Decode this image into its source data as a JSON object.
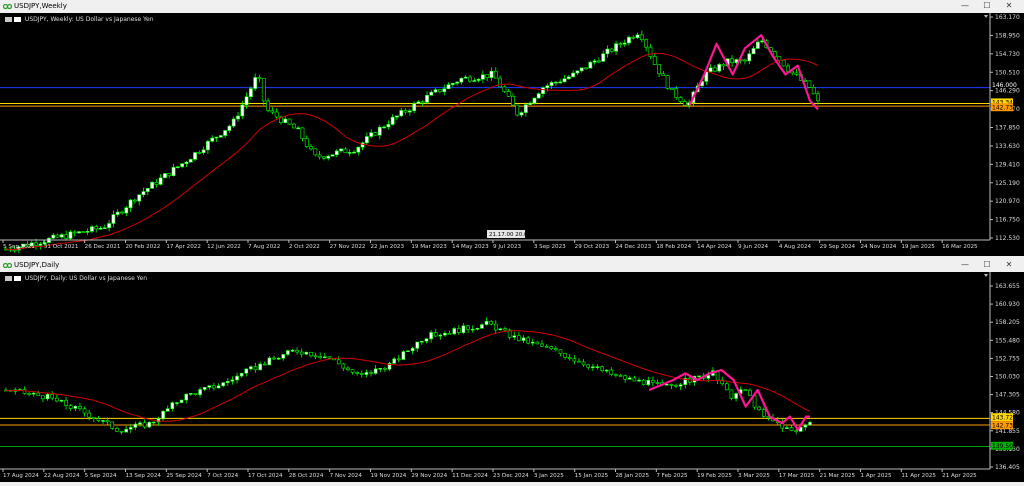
{
  "top": {
    "window_title": "USDJPY,Weekly",
    "info_text": "USDJPY, Weekly:  US Dollar vs Japanese Yen",
    "price_ticks": [
      "163.170",
      "158.950",
      "154.730",
      "150.510",
      "146.290",
      "142.070",
      "137.850",
      "133.630",
      "129.410",
      "125.190",
      "120.970",
      "116.750",
      "112.530"
    ],
    "price_labels": [
      {
        "text": "143.344",
        "color": "#ffd700"
      },
      {
        "text": "142.737",
        "color": "#ff9a00"
      }
    ],
    "blue_label": "146.000",
    "date_labels": [
      "5 Sep 2021",
      "31 Oct 2021",
      "26 Dec 2021",
      "20 Feb 2022",
      "17 Apr 2022",
      "12 Jun 2022",
      "7 Aug 2022",
      "2 Oct 2022",
      "27 Nov 2022",
      "22 Jan 2023",
      "19 Mar 2023",
      "14 May 2023",
      "9 Jul 2023",
      "3 Sep 2023",
      "29 Oct 2023",
      "24 Dec 2023",
      "18 Feb 2024",
      "14 Apr 2024",
      "9 Jun 2024",
      "4 Aug 2024",
      "29 Sep 2024",
      "24 Nov 2024",
      "19 Jan 2025",
      "16 Mar 2025"
    ],
    "crosshair_label": "21.17.00   20.00"
  },
  "bottom": {
    "window_title": "USDJPY,Daily",
    "info_text": "USDJPY, Daily:  US Dollar vs Japanese Yen",
    "price_ticks": [
      "163.655",
      "160.930",
      "158.205",
      "155.480",
      "152.755",
      "150.030",
      "147.305",
      "144.580",
      "141.855",
      "139.130",
      "136.405"
    ],
    "price_labels": [
      {
        "text": "143.721",
        "color": "#ffd700"
      },
      {
        "text": "142.737",
        "color": "#ff9a00"
      },
      {
        "text": "139.500",
        "color": "#00b000"
      }
    ],
    "date_labels": [
      "17 Aug 2024",
      "22 Aug 2024",
      "5 Sep 2024",
      "13 Sep 2024",
      "25 Sep 2024",
      "7 Oct 2024",
      "17 Oct 2024",
      "28 Oct 2024",
      "7 Nov 2024",
      "19 Nov 2024",
      "29 Nov 2024",
      "11 Dec 2024",
      "23 Dec 2024",
      "3 Jan 2025",
      "15 Jan 2025",
      "28 Jan 2025",
      "7 Feb 2025",
      "19 Feb 2025",
      "3 Mar 2025",
      "17 Mar 2025",
      "21 Mar 2025",
      "1 Apr 2025",
      "11 Apr 2025",
      "21 Apr 2025"
    ]
  },
  "window_buttons": {
    "minimize": "—",
    "maximize": "☐",
    "close": "✕"
  },
  "colors": {
    "bull": "#ffffff",
    "bull_outline": "#00ff00",
    "ma": "#d00000",
    "pattern": "#ff1493",
    "gold": "#ffd700",
    "orange": "#ff9a00",
    "blue": "#1e3cff",
    "green": "#00a000"
  }
}
